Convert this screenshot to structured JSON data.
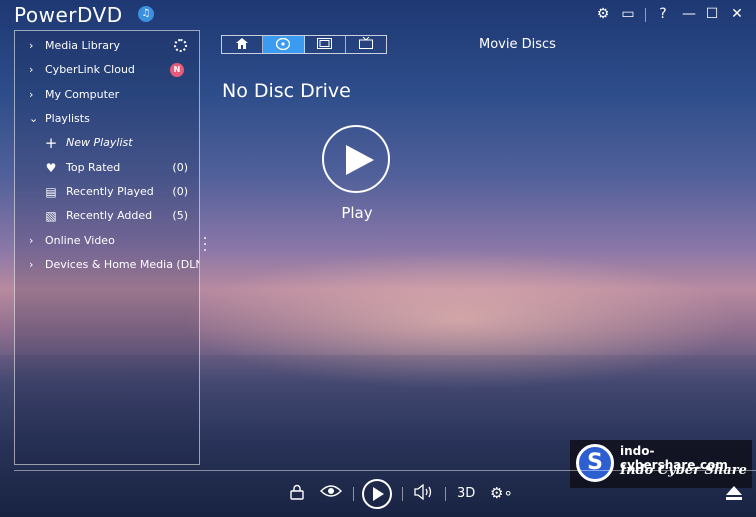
{
  "app": {
    "title": "PowerDVD"
  },
  "window_controls": [
    "gear-icon",
    "tv-mode-icon",
    "help-icon",
    "minimize-icon",
    "maximize-icon",
    "close-icon"
  ],
  "window_glyphs": {
    "gear": "⚙",
    "tv": "▭",
    "help": "?",
    "minimize": "—",
    "maximize": "☐",
    "close": "✕"
  },
  "sidebar": {
    "media_library": "Media Library",
    "cyberlink_cloud": "CyberLink Cloud",
    "cloud_badge": "N",
    "my_computer": "My Computer",
    "playlists": "Playlists",
    "new_playlist": "New Playlist",
    "top_rated": {
      "label": "Top Rated",
      "count": "(0)"
    },
    "recently_played": {
      "label": "Recently Played",
      "count": "(0)"
    },
    "recently_added": {
      "label": "Recently Added",
      "count": "(5)"
    },
    "online_video": "Online Video",
    "devices": "Devices & Home Media (DLNA"
  },
  "tabs": [
    {
      "name": "home-tab",
      "icon": "home-icon"
    },
    {
      "name": "disc-tab",
      "icon": "disc-icon",
      "active": true
    },
    {
      "name": "movies-tab",
      "icon": "film-icon"
    },
    {
      "name": "tv-tab",
      "icon": "tv-icon"
    }
  ],
  "main": {
    "section_title": "Movie Discs",
    "disc_status": "No Disc Drive",
    "play_label": "Play"
  },
  "watermark": {
    "url": "indo-cybershare.com",
    "name": "Indo Cyber Share",
    "logo_letter": "S"
  },
  "controls": {
    "three_d_label": "3D",
    "icons": [
      "lock-icon",
      "eye-icon",
      "play-icon",
      "volume-icon",
      "3d-label",
      "settings-icon",
      "eject-icon"
    ]
  },
  "colors": {
    "accent": "#3b9bf0",
    "badge": "#e85a7a",
    "bell": "#3d8fe0"
  }
}
